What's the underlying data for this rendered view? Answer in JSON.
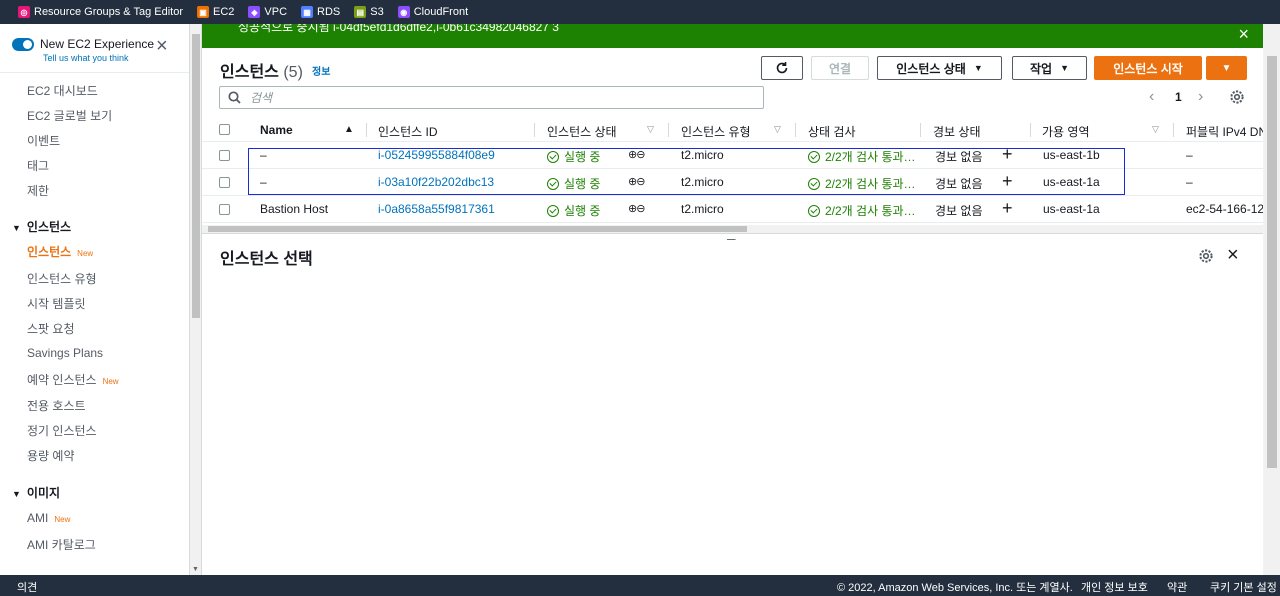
{
  "topbar": {
    "services": [
      {
        "label": "Resource Groups & Tag Editor",
        "icon": "resource-groups-icon",
        "color": "#e7157b"
      },
      {
        "label": "EC2",
        "icon": "ec2-icon",
        "color": "#ed7100"
      },
      {
        "label": "VPC",
        "icon": "vpc-icon",
        "color": "#8c4fff"
      },
      {
        "label": "RDS",
        "icon": "rds-icon",
        "color": "#527fff"
      },
      {
        "label": "S3",
        "icon": "s3-icon",
        "color": "#7aa116"
      },
      {
        "label": "CloudFront",
        "icon": "cloudfront-icon",
        "color": "#8c4fff"
      }
    ]
  },
  "sidebar": {
    "experience_title": "New EC2 Experience",
    "experience_sub": "Tell us what you think",
    "items": [
      {
        "label": "EC2 대시보드"
      },
      {
        "label": "EC2 글로벌 보기"
      },
      {
        "label": "이벤트"
      },
      {
        "label": "태그"
      },
      {
        "label": "제한"
      }
    ],
    "section_instances": "인스턴스",
    "instances_items": [
      {
        "label": "인스턴스",
        "badge": "New",
        "active": true
      },
      {
        "label": "인스턴스 유형"
      },
      {
        "label": "시작 템플릿"
      },
      {
        "label": "스팟 요청"
      },
      {
        "label": "Savings Plans"
      },
      {
        "label": "예약 인스턴스",
        "badge": "New"
      },
      {
        "label": "전용 호스트"
      },
      {
        "label": "정기 인스턴스"
      },
      {
        "label": "용량 예약"
      }
    ],
    "section_images": "이미지",
    "images_items": [
      {
        "label": "AMI",
        "badge": "New"
      },
      {
        "label": "AMI 카탈로그"
      }
    ]
  },
  "flash": {
    "text": "성공적으로 중지됨 i-04df5efd1d6dffe2,i-0b61c34982046827 3"
  },
  "panel": {
    "title": "인스턴스",
    "count": "(5)",
    "info": "정보",
    "buttons": {
      "connect": "연결",
      "state": "인스턴스 상태",
      "actions": "작업",
      "launch": "인스턴스 시작"
    },
    "search_placeholder": "검색",
    "page": "1"
  },
  "table": {
    "headers": [
      "Name",
      "인스턴스 ID",
      "인스턴스 상태",
      "인스턴스 유형",
      "상태 검사",
      "경보 상태",
      "가용 영역",
      "퍼블릭 IPv4 DN"
    ],
    "rows": [
      {
        "name": "–",
        "id": "i-052459955884f08e9",
        "state": "실행 중",
        "type": "t2.micro",
        "check": "2/2개 검사 통과…",
        "alarm": "경보 없음",
        "az": "us-east-1b",
        "dns": "–"
      },
      {
        "name": "–",
        "id": "i-03a10f22b202dbc13",
        "state": "실행 중",
        "type": "t2.micro",
        "check": "2/2개 검사 통과…",
        "alarm": "경보 없음",
        "az": "us-east-1a",
        "dns": "–"
      },
      {
        "name": "Bastion Host",
        "id": "i-0a8658a55f9817361",
        "state": "실행 중",
        "type": "t2.micro",
        "check": "2/2개 검사 통과…",
        "alarm": "경보 없음",
        "az": "us-east-1a",
        "dns": "ec2-54-166-12"
      }
    ]
  },
  "detail": {
    "title": "인스턴스 선택"
  },
  "footer": {
    "feedback": "의견",
    "copyright": "© 2022, Amazon Web Services, Inc. 또는 계열사.",
    "privacy": "개인 정보 보호",
    "terms": "약관",
    "cookies": "쿠키 기본 설정"
  }
}
